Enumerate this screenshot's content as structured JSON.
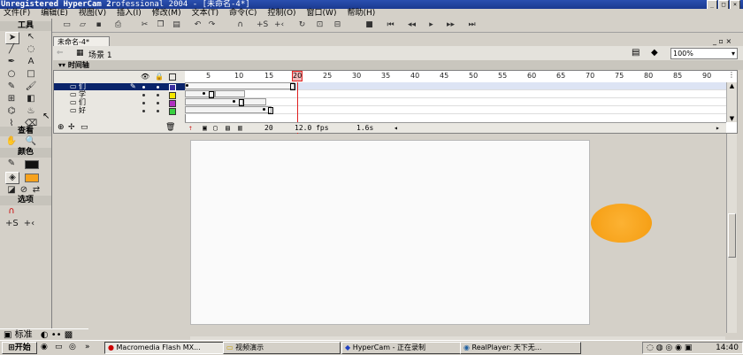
{
  "titlebar": {
    "watermark": "Unregistered HyperCam 2",
    "title_tail": "rofessional 2004 - [未命名-4*]"
  },
  "menu": [
    "文件(F)",
    "编辑(E)",
    "视图(V)",
    "插入(I)",
    "修改(M)",
    "文本(T)",
    "命令(C)",
    "控制(O)",
    "窗口(W)",
    "帮助(H)"
  ],
  "tools": {
    "title": "工具",
    "view_label": "查看",
    "colors_label": "颜色",
    "options_label": "选项"
  },
  "document": {
    "tab_label": "未命名-4*",
    "scene_label": "场景 1",
    "zoom": "100%"
  },
  "timeline": {
    "header_label": "时间轴",
    "ruler_ticks": [
      "5",
      "10",
      "15",
      "20",
      "25",
      "30",
      "35",
      "40",
      "45",
      "50",
      "55",
      "60",
      "65",
      "70",
      "75",
      "80",
      "85",
      "90"
    ],
    "current_frame_mark": "20",
    "layers": [
      {
        "name": "们"
      },
      {
        "name": "学"
      },
      {
        "name": "们"
      },
      {
        "name": "好"
      }
    ],
    "layer_colors": [
      "#3a2fa0",
      "#f5e600",
      "#b030c0",
      "#39d040"
    ],
    "status": {
      "current_frame": "20",
      "fps": "12.0 fps",
      "elapsed": "1.6s"
    }
  },
  "stage": {
    "shape_color": "#f7a21c"
  },
  "bottom": {
    "standard_label": "标准"
  },
  "taskbar": {
    "start": "开始",
    "tasks": [
      "Macromedia Flash MX...",
      "视频演示",
      "HyperCam - 正在录制",
      "RealPlayer: 天下无..."
    ],
    "clock": "14:40"
  }
}
